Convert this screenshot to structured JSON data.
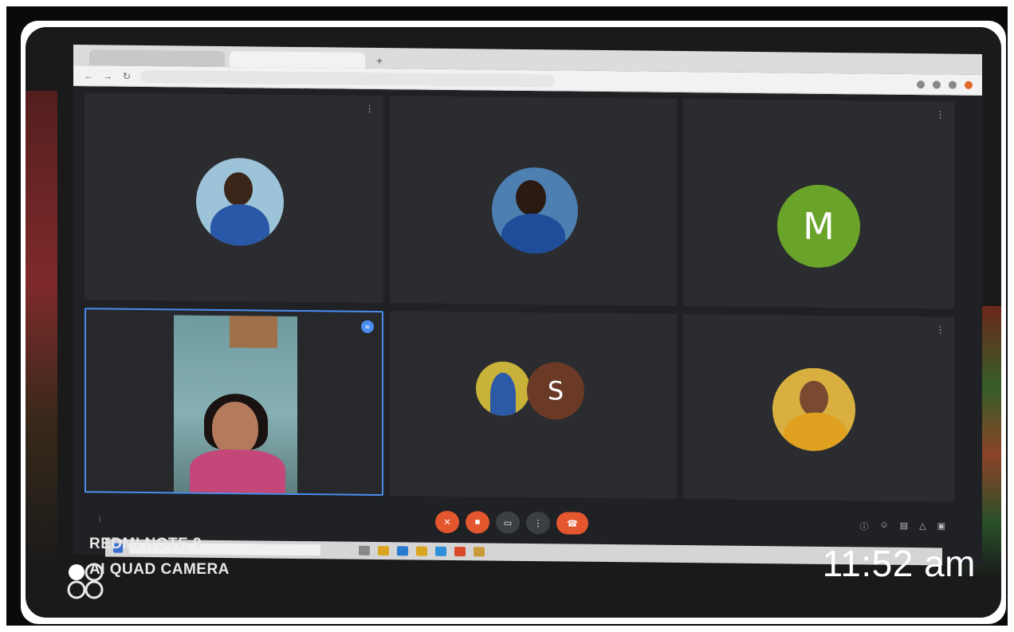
{
  "browser": {
    "tabs": [
      "",
      ""
    ],
    "new_tab": "+",
    "url": "",
    "nav": [
      "←",
      "→",
      "↻"
    ]
  },
  "meet": {
    "tiles": [
      {
        "name": "",
        "kind": "photo"
      },
      {
        "name": "",
        "kind": "photo"
      },
      {
        "name": "",
        "kind": "letter",
        "letter": "M",
        "color": "#6aa329"
      },
      {
        "name": "",
        "kind": "video",
        "speaking": true
      },
      {
        "name": "",
        "kind": "group",
        "letter": "S",
        "color": "#6b3a26"
      },
      {
        "name": "",
        "kind": "photo"
      }
    ],
    "controls": {
      "time": "",
      "meeting_code": "",
      "more": "⋮"
    }
  },
  "taskbar": {
    "search_placeholder": ""
  },
  "watermark": {
    "line1": "REDMI NOTE 9",
    "line2": "AI QUAD CAMERA",
    "time": "11:52 am"
  }
}
